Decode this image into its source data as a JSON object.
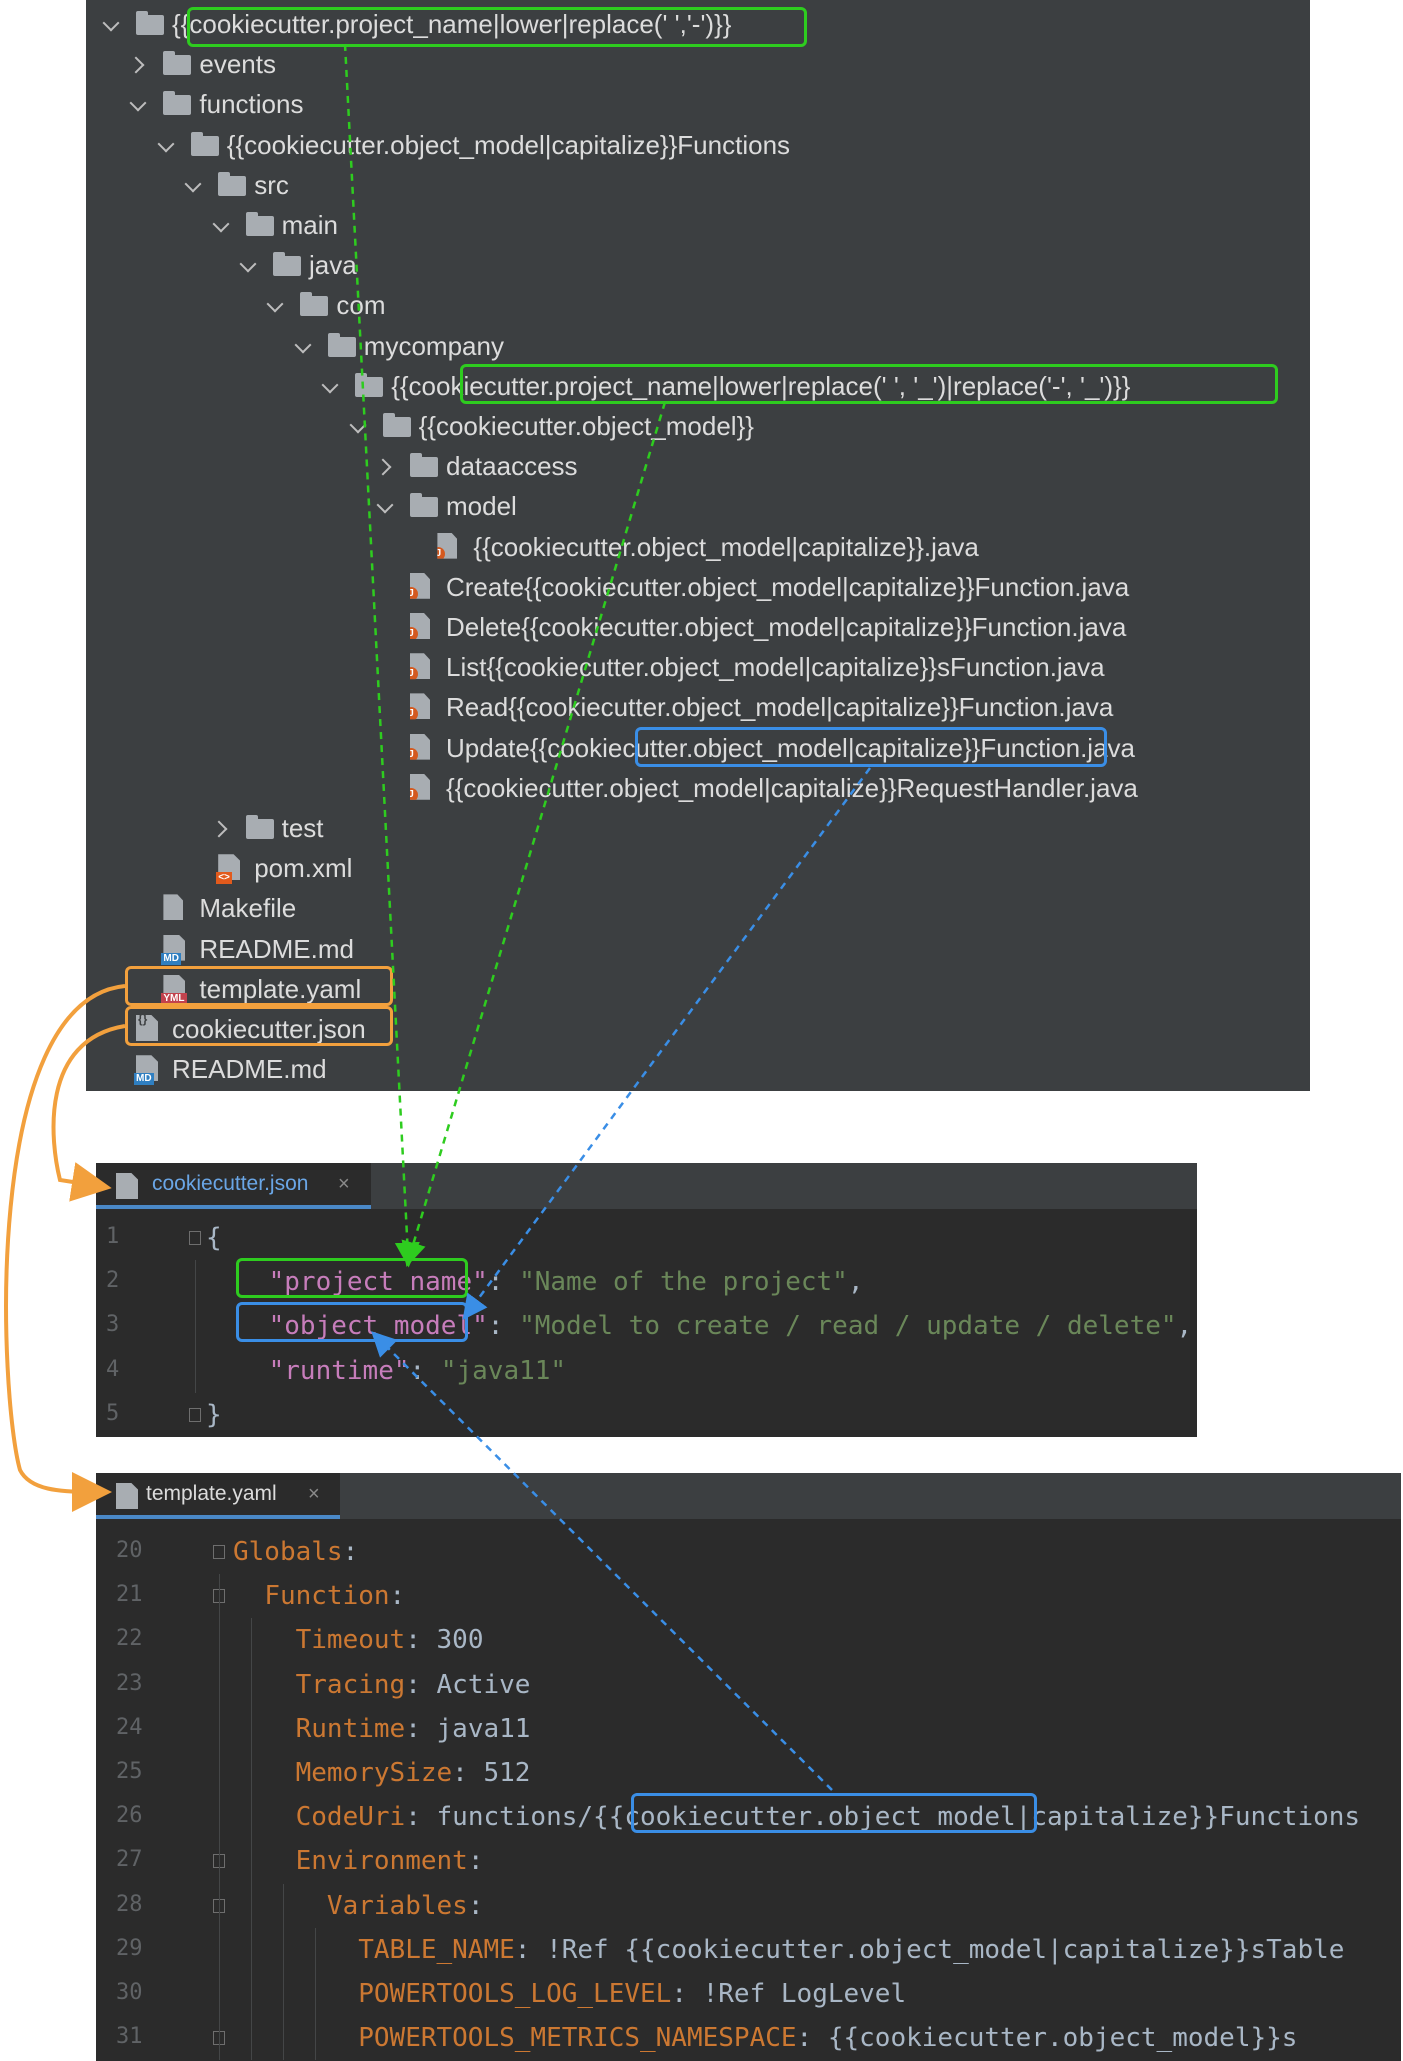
{
  "tree": {
    "items": [
      {
        "label": "{{cookiecutter.project_name|lower|replace(' ','-')}}",
        "kind": "folder",
        "state": "open",
        "indent": 0
      },
      {
        "label": "events",
        "kind": "folder",
        "state": "closed",
        "indent": 1
      },
      {
        "label": "functions",
        "kind": "folder",
        "state": "open",
        "indent": 1
      },
      {
        "label": "{{cookiecutter.object_model|capitalize}}Functions",
        "kind": "folder",
        "state": "open",
        "indent": 2
      },
      {
        "label": "src",
        "kind": "folder",
        "state": "open",
        "indent": 3
      },
      {
        "label": "main",
        "kind": "folder",
        "state": "open",
        "indent": 4
      },
      {
        "label": "java",
        "kind": "folder",
        "state": "open",
        "indent": 5
      },
      {
        "label": "com",
        "kind": "folder",
        "state": "open",
        "indent": 6
      },
      {
        "label": "mycompany",
        "kind": "folder",
        "state": "open",
        "indent": 7
      },
      {
        "label": "{{cookiecutter.project_name|lower|replace(' ', '_')|replace('-', '_')}}",
        "kind": "folder",
        "state": "open",
        "indent": 8
      },
      {
        "label": "{{cookiecutter.object_model}}",
        "kind": "folder",
        "state": "open",
        "indent": 9
      },
      {
        "label": "dataaccess",
        "kind": "folder",
        "state": "closed",
        "indent": 10
      },
      {
        "label": "model",
        "kind": "folder",
        "state": "open",
        "indent": 10
      },
      {
        "label": "{{cookiecutter.object_model|capitalize}}.java",
        "kind": "java",
        "indent": 11
      },
      {
        "label": "Create{{cookiecutter.object_model|capitalize}}Function.java",
        "kind": "java",
        "indent": 10
      },
      {
        "label": "Delete{{cookiecutter.object_model|capitalize}}Function.java",
        "kind": "java",
        "indent": 10
      },
      {
        "label": "List{{cookiecutter.object_model|capitalize}}sFunction.java",
        "kind": "java",
        "indent": 10
      },
      {
        "label": "Read{{cookiecutter.object_model|capitalize}}Function.java",
        "kind": "java",
        "indent": 10
      },
      {
        "label": "Update{{cookiecutter.object_model|capitalize}}Function.java",
        "kind": "java",
        "indent": 10
      },
      {
        "label": "{{cookiecutter.object_model|capitalize}}RequestHandler.java",
        "kind": "java",
        "indent": 10
      },
      {
        "label": "test",
        "kind": "folder",
        "state": "closed",
        "indent": 4
      },
      {
        "label": "pom.xml",
        "kind": "xml",
        "indent": 3
      },
      {
        "label": "Makefile",
        "kind": "doc",
        "indent": 1
      },
      {
        "label": "README.md",
        "kind": "md",
        "indent": 1
      },
      {
        "label": "template.yaml",
        "kind": "yml",
        "indent": 1
      },
      {
        "label": "cookiecutter.json",
        "kind": "json",
        "indent": 0
      },
      {
        "label": "README.md",
        "kind": "md",
        "indent": 0
      }
    ],
    "badges": {
      "md": "MD",
      "yml": "YML",
      "xml": "<>"
    }
  },
  "json_editor": {
    "tab_label": "cookiecutter.json",
    "close": "×",
    "lines": [
      {
        "num": "1",
        "tokens": [
          {
            "t": "{",
            "c": "p"
          }
        ]
      },
      {
        "num": "2",
        "tokens": [
          {
            "t": "    ",
            "c": "p"
          },
          {
            "t": "\"project_name\"",
            "c": "k-json"
          },
          {
            "t": ": ",
            "c": "p"
          },
          {
            "t": "\"Name of the project\"",
            "c": "s-json"
          },
          {
            "t": ",",
            "c": "p"
          }
        ]
      },
      {
        "num": "3",
        "tokens": [
          {
            "t": "    ",
            "c": "p"
          },
          {
            "t": "\"object_model\"",
            "c": "k-json"
          },
          {
            "t": ": ",
            "c": "p"
          },
          {
            "t": "\"Model to create / read / update / delete\"",
            "c": "s-json"
          },
          {
            "t": ",",
            "c": "p"
          }
        ]
      },
      {
        "num": "4",
        "tokens": [
          {
            "t": "    ",
            "c": "p"
          },
          {
            "t": "\"runtime\"",
            "c": "k-json"
          },
          {
            "t": ": ",
            "c": "p"
          },
          {
            "t": "\"java11\"",
            "c": "s-json"
          }
        ]
      },
      {
        "num": "5",
        "tokens": [
          {
            "t": "}",
            "c": "p"
          }
        ]
      }
    ]
  },
  "yaml_editor": {
    "tab_label": "template.yaml",
    "close": "×",
    "lines": [
      {
        "num": "20",
        "tokens": [
          {
            "t": "Globals",
            "c": "k-yaml"
          },
          {
            "t": ":",
            "c": "v-yaml"
          }
        ]
      },
      {
        "num": "21",
        "tokens": [
          {
            "t": "  ",
            "c": "v-yaml"
          },
          {
            "t": "Function",
            "c": "k-yaml"
          },
          {
            "t": ":",
            "c": "v-yaml"
          }
        ]
      },
      {
        "num": "22",
        "tokens": [
          {
            "t": "    ",
            "c": "v-yaml"
          },
          {
            "t": "Timeout",
            "c": "k-yaml"
          },
          {
            "t": ": 300",
            "c": "v-yaml"
          }
        ]
      },
      {
        "num": "23",
        "tokens": [
          {
            "t": "    ",
            "c": "v-yaml"
          },
          {
            "t": "Tracing",
            "c": "k-yaml"
          },
          {
            "t": ": Active",
            "c": "v-yaml"
          }
        ]
      },
      {
        "num": "24",
        "tokens": [
          {
            "t": "    ",
            "c": "v-yaml"
          },
          {
            "t": "Runtime",
            "c": "k-yaml"
          },
          {
            "t": ": java11",
            "c": "v-yaml"
          }
        ]
      },
      {
        "num": "25",
        "tokens": [
          {
            "t": "    ",
            "c": "v-yaml"
          },
          {
            "t": "MemorySize",
            "c": "k-yaml"
          },
          {
            "t": ": 512",
            "c": "v-yaml"
          }
        ]
      },
      {
        "num": "26",
        "tokens": [
          {
            "t": "    ",
            "c": "v-yaml"
          },
          {
            "t": "CodeUri",
            "c": "k-yaml"
          },
          {
            "t": ": functions/{{cookiecutter.object_model|capitalize}}Functions",
            "c": "v-yaml"
          }
        ]
      },
      {
        "num": "27",
        "tokens": [
          {
            "t": "    ",
            "c": "v-yaml"
          },
          {
            "t": "Environment",
            "c": "k-yaml"
          },
          {
            "t": ":",
            "c": "v-yaml"
          }
        ]
      },
      {
        "num": "28",
        "tokens": [
          {
            "t": "      ",
            "c": "v-yaml"
          },
          {
            "t": "Variables",
            "c": "k-yaml"
          },
          {
            "t": ":",
            "c": "v-yaml"
          }
        ]
      },
      {
        "num": "29",
        "tokens": [
          {
            "t": "        ",
            "c": "v-yaml"
          },
          {
            "t": "TABLE_NAME",
            "c": "k-yaml"
          },
          {
            "t": ": !Ref {{cookiecutter.object_model|capitalize}}sTable",
            "c": "v-yaml"
          }
        ]
      },
      {
        "num": "30",
        "tokens": [
          {
            "t": "        ",
            "c": "v-yaml"
          },
          {
            "t": "POWERTOOLS_LOG_LEVEL",
            "c": "k-yaml"
          },
          {
            "t": ": !Ref LogLevel",
            "c": "v-yaml"
          }
        ]
      },
      {
        "num": "31",
        "tokens": [
          {
            "t": "        ",
            "c": "v-yaml"
          },
          {
            "t": "POWERTOOLS_METRICS_NAMESPACE",
            "c": "k-yaml"
          },
          {
            "t": ": {{cookiecutter.object_model}}s",
            "c": "v-yaml"
          }
        ]
      }
    ]
  },
  "colors": {
    "green_link": "#2ecc1f",
    "blue_link": "#3a8ee6",
    "orange_link": "#f2a03d",
    "tab_text": "#6aa6e6",
    "tab_text_yaml": "#dcdcdc"
  }
}
